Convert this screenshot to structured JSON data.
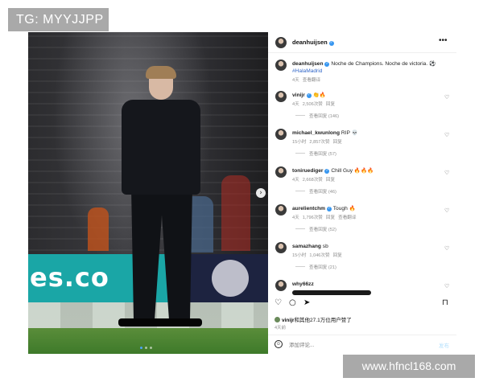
{
  "watermarks": {
    "top_left": "TG: MYYJJPP",
    "bottom_right": "www.hfncl168.com"
  },
  "photo": {
    "banner_text": "es.co",
    "carousel_dots": 3,
    "active_dot": 1
  },
  "post": {
    "author": "deanhuijsen",
    "caption_author": "deanhuijsen",
    "caption_text": "Noche de Champions. Noche de victoria.",
    "caption_hashtag": "#HalaMadrid",
    "caption_time": "4天",
    "caption_translate": "查看翻译"
  },
  "comments": [
    {
      "user": "vinijr",
      "verified": true,
      "text": "",
      "emoji": "👏🔥",
      "time": "4天",
      "likes": "2,506次赞",
      "reply": "回复",
      "translate": "",
      "replies": "查看回复 (146)"
    },
    {
      "user": "michael_kwunlong",
      "verified": false,
      "text": "RIP",
      "emoji": "💀",
      "time": "15小时",
      "likes": "2,857次赞",
      "reply": "回复",
      "translate": "",
      "replies": "查看回复 (57)"
    },
    {
      "user": "toniruediger",
      "verified": true,
      "text": "Chill Guy",
      "emoji": "🔥🔥🔥",
      "time": "4天",
      "likes": "2,668次赞",
      "reply": "回复",
      "translate": "",
      "replies": "查看回复 (46)"
    },
    {
      "user": "aurelientchm",
      "verified": true,
      "text": "Tough",
      "emoji": "🔥",
      "time": "4天",
      "likes": "1,796次赞",
      "reply": "回复",
      "translate": "查看翻译",
      "replies": "查看回复 (52)"
    },
    {
      "user": "samazhang",
      "verified": false,
      "text": "sb",
      "emoji": "",
      "time": "15小时",
      "likes": "1,046次赞",
      "reply": "回复",
      "translate": "",
      "replies": "查看回复 (21)"
    },
    {
      "user": "why66zz",
      "verified": false,
      "text": "",
      "emoji": "",
      "time": "",
      "likes": "",
      "reply": "",
      "translate": "",
      "replies": ""
    }
  ],
  "likes_line": {
    "liker": "vinijr",
    "text": "和其他27.1万位用户赞了"
  },
  "post_age": "4天前",
  "comment_box": {
    "placeholder": "添加评论...",
    "post_label": "发布"
  },
  "icons": {
    "more": "more-horizontal-icon",
    "like": "heart-icon",
    "comment": "comment-icon",
    "share": "share-icon",
    "save": "bookmark-icon",
    "emoji": "smile-icon",
    "next": "chevron-right-icon"
  },
  "colors": {
    "verified": "#3897f0",
    "hashtag": "#3166c8",
    "watermark_bg": "#a9a9a9",
    "banner": "#1aa6a6"
  }
}
